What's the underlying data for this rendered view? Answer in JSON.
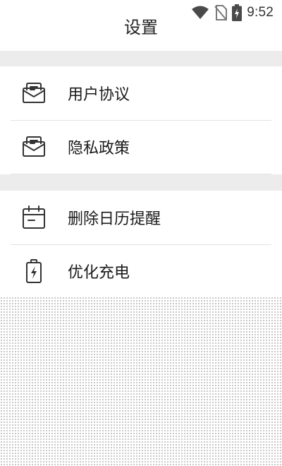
{
  "status_bar": {
    "time": "9:52",
    "icons": [
      "wifi-icon",
      "no-sim-icon",
      "battery-charging-icon"
    ]
  },
  "header": {
    "title": "设置"
  },
  "sections": [
    {
      "items": [
        {
          "label": "用户协议",
          "icon": "mail-icon"
        },
        {
          "label": "隐私政策",
          "icon": "mail-icon"
        }
      ]
    },
    {
      "items": [
        {
          "label": "删除日历提醒",
          "icon": "calendar-icon"
        },
        {
          "label": "优化充电",
          "icon": "battery-charging-icon"
        }
      ]
    }
  ],
  "colors": {
    "text": "#1a1a1a",
    "separator": "#ececec",
    "divider": "#e2e2e2",
    "icon": "#333333"
  }
}
